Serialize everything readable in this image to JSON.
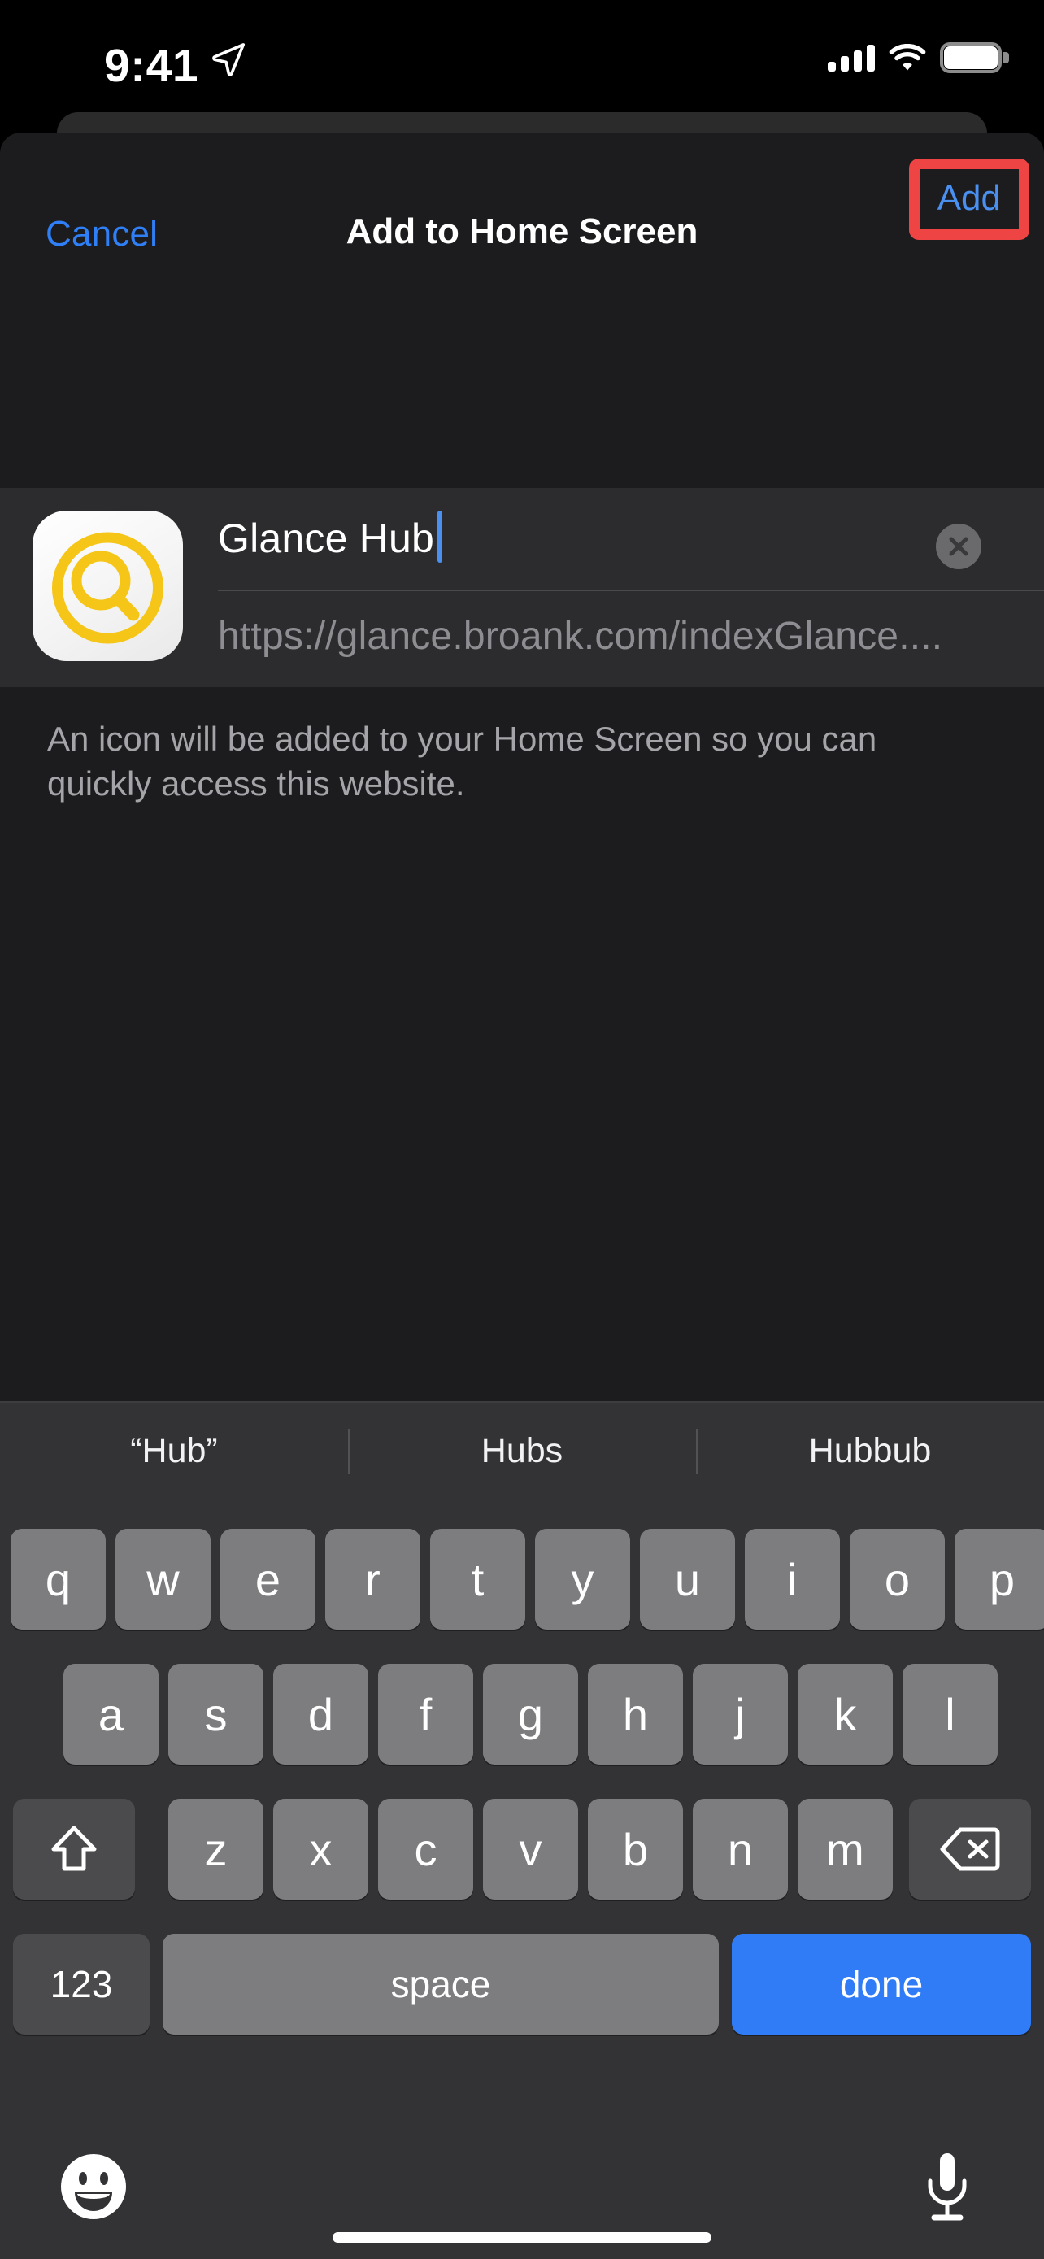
{
  "status_bar": {
    "time": "9:41",
    "location_icon": "location-arrow-icon",
    "cellular_icon": "cellular-bars-icon",
    "wifi_icon": "wifi-icon",
    "battery_icon": "battery-full-icon"
  },
  "nav": {
    "cancel_label": "Cancel",
    "title": "Add to Home Screen",
    "add_label": "Add",
    "highlight_color": "#ef4444",
    "accent_color": "#2f80f7"
  },
  "form": {
    "app_icon_name": "magnifying-glass-app-icon",
    "icon_color": "#F5C518",
    "name_value": "Glance Hub",
    "name_placeholder": "Name",
    "clear_icon": "clear-circle-x-icon",
    "url_value": "https://glance.broank.com/indexGlance....",
    "url_placeholder": "Address"
  },
  "footnote": "An icon will be added to your Home Screen so you can quickly access this website.",
  "keyboard": {
    "predictions": [
      "“Hub”",
      "Hubs",
      "Hubbub"
    ],
    "row1": [
      "q",
      "w",
      "e",
      "r",
      "t",
      "y",
      "u",
      "i",
      "o",
      "p"
    ],
    "row2": [
      "a",
      "s",
      "d",
      "f",
      "g",
      "h",
      "j",
      "k",
      "l"
    ],
    "row3": [
      "z",
      "x",
      "c",
      "v",
      "b",
      "n",
      "m"
    ],
    "shift_icon": "shift-arrow-icon",
    "backspace_icon": "backspace-delete-icon",
    "numbers_label": "123",
    "space_label": "space",
    "return_label": "done",
    "return_color": "#2f7cf6",
    "emoji_icon": "emoji-smiley-icon",
    "dictation_icon": "microphone-icon"
  },
  "home_indicator": "home-indicator-bar"
}
